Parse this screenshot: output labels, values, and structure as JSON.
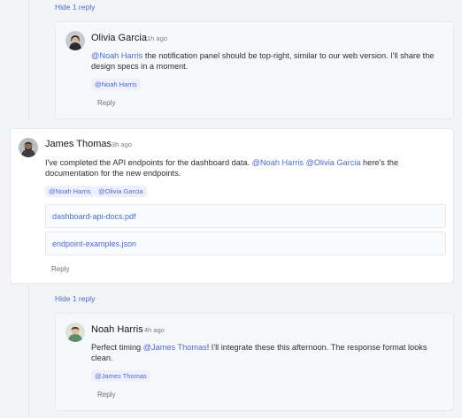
{
  "thread1": {
    "hide_replies": "Hide 1 reply",
    "reply": {
      "author": "Olivia Garcia",
      "time": "1h ago",
      "mention": "@Noah Harris",
      "text_line1_rest": " the notification panel should be top-right, similar to our web version. I'll share the",
      "text_line2": "design specs in a moment.",
      "tags": [
        "@Noah Harris"
      ],
      "reply_label": "Reply"
    }
  },
  "comment": {
    "author": "James Thomas",
    "time": "3h ago",
    "text_line1_start": "I've completed the API endpoints for the dashboard data. ",
    "mention1": "@Noah Harris",
    "mention2": "@Olivia Garcia",
    "text_line1_end": " here's the",
    "text_line2": "documentation for the new endpoints.",
    "tags": [
      "@Noah Harris",
      "@Olivia Garcia"
    ],
    "attachments": [
      "dashboard-api-docs.pdf",
      "endpoint-examples.json"
    ],
    "reply_label": "Reply"
  },
  "thread2": {
    "hide_replies": "Hide 1 reply",
    "reply": {
      "author": "Noah Harris",
      "time": "4h ago",
      "text_start": "Perfect timing ",
      "mention": "@James Thomas",
      "text_line1_rest": "! I'll integrate these this afternoon. The response format looks",
      "text_line2": "clean.",
      "tags": [
        "@James Thomas"
      ],
      "reply_label": "Reply"
    }
  }
}
